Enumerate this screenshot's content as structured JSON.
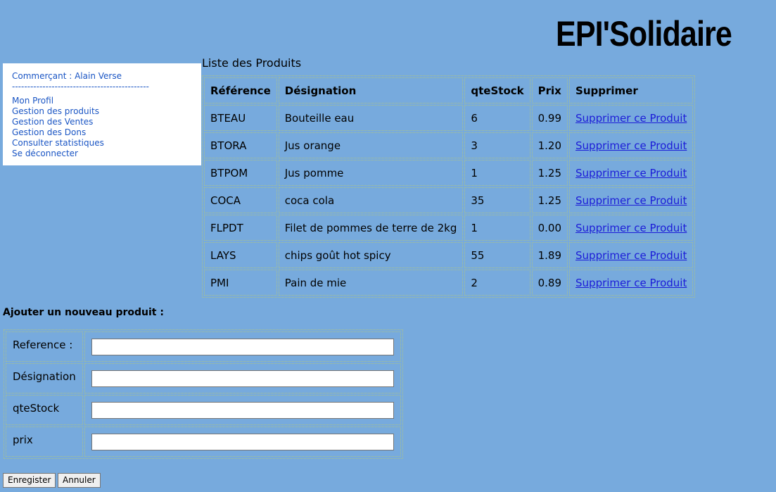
{
  "header": {
    "logo": "EPI'Solidaire"
  },
  "sidebar": {
    "merchant": "Commerçant : Alain Verse",
    "separator": "---------------------------------------------",
    "menu": [
      "Mon Profil",
      "Gestion des produits",
      "Gestion des Ventes",
      "Gestion des Dons",
      "Consulter statistiques",
      "Se déconnecter"
    ]
  },
  "products": {
    "title": "Liste des Produits",
    "columns": [
      "Référence",
      "Désignation",
      "qteStock",
      "Prix",
      "Supprimer"
    ],
    "rows": [
      [
        "BTEAU",
        "Bouteille eau",
        "6",
        "0.99",
        "Supprimer ce Produit"
      ],
      [
        "BTORA",
        "Jus orange",
        "3",
        "1.20",
        "Supprimer ce Produit"
      ],
      [
        "BTPOM",
        "Jus pomme",
        "1",
        "1.25",
        "Supprimer ce Produit"
      ],
      [
        "COCA",
        "coca cola",
        "35",
        "1.25",
        "Supprimer ce Produit"
      ],
      [
        "FLPDT",
        "Filet de pommes de terre de 2kg",
        "1",
        "0.00",
        "Supprimer ce Produit"
      ],
      [
        "LAYS",
        "chips goût hot spicy",
        "55",
        "1.89",
        "Supprimer ce Produit"
      ],
      [
        "PMI",
        "Pain de mie",
        "2",
        "0.89",
        "Supprimer ce Produit"
      ]
    ]
  },
  "form": {
    "title": "Ajouter un nouveau produit :",
    "fields": [
      {
        "label": "Reference :",
        "value": ""
      },
      {
        "label": "Désignation",
        "value": ""
      },
      {
        "label": "qteStock",
        "value": ""
      },
      {
        "label": "prix",
        "value": ""
      }
    ],
    "save_label": "Enregister",
    "cancel_label": "Annuler"
  }
}
